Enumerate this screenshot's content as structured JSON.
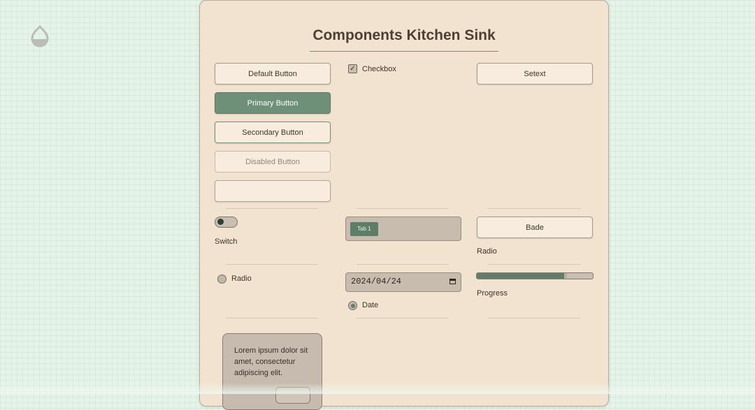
{
  "page": {
    "title": "Components Kitchen Sink"
  },
  "buttons": {
    "default": "Default Button",
    "primary": "Primary Button",
    "secondary": "Secondary Button",
    "disabled": "Disabled Button",
    "empty": "",
    "setext": "Setext",
    "badge": "Bade"
  },
  "checkbox": {
    "label": "Checkbox",
    "checked": true
  },
  "switch": {
    "label": "Switch",
    "on": false
  },
  "radio": {
    "label": "Radio",
    "checked": false
  },
  "radio_label_right": "Radio",
  "tabs": {
    "items": [
      "Tab 1"
    ],
    "active": "Tab 1"
  },
  "date_input": {
    "value": "2024/04/24"
  },
  "date_radio": {
    "label": "Date",
    "checked": true
  },
  "progress": {
    "label": "Progress",
    "value_fraction": 0.75
  },
  "popover": {
    "text": "Lorem ipsum dolor sit amet, consectetur adipiscing elit.",
    "button_label": ""
  },
  "colors": {
    "accent": "#6e9079",
    "card_bg": "#f1e3cf",
    "page_bg": "#e5f3e9",
    "heading": "#4e3f33"
  },
  "icons": {
    "logo": "water-drop-icon",
    "checkbox_mark": "checkmark-icon",
    "calendar": "calendar-icon"
  }
}
